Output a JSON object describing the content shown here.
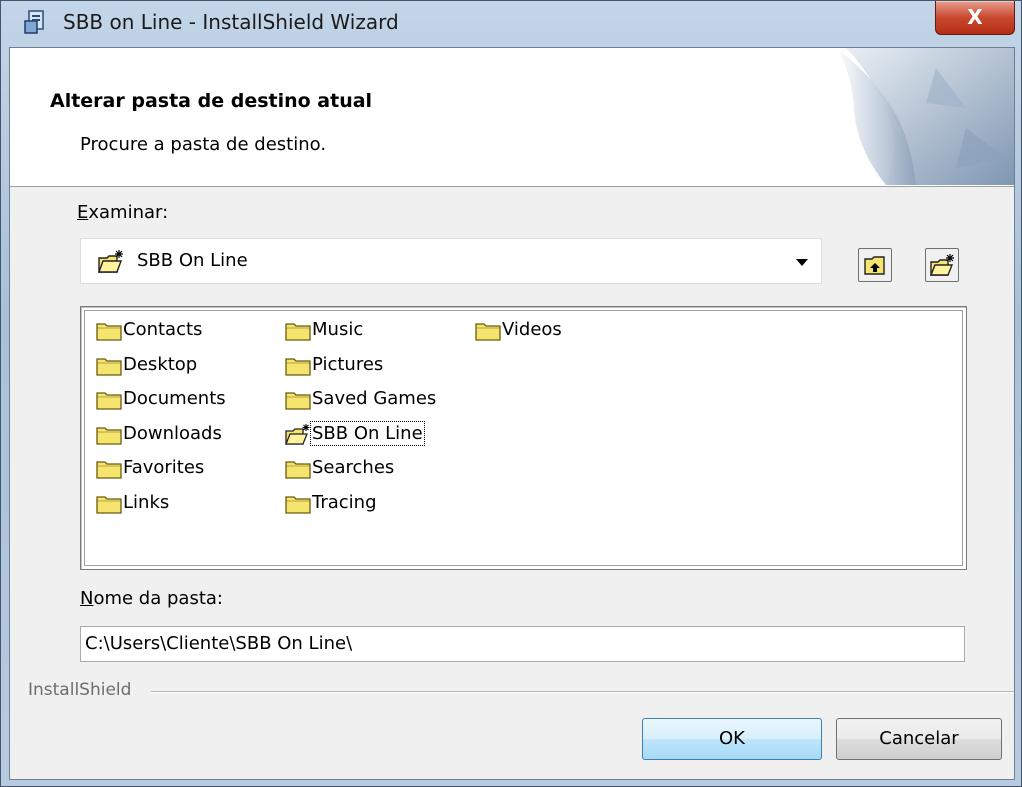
{
  "window": {
    "title": "SBB on Line - InstallShield Wizard",
    "close_glyph": "X"
  },
  "header": {
    "title": "Alterar pasta de destino atual",
    "subtitle": "Procure a pasta de destino."
  },
  "browse": {
    "label_accel": "E",
    "label_rest": "xaminar:",
    "selected_value": "SBB On Line",
    "up_folder_icon": "up-one-level-icon",
    "new_folder_icon": "new-folder-icon"
  },
  "folders": {
    "col1": [
      "Contacts",
      "Desktop",
      "Documents",
      "Downloads",
      "Favorites",
      "Links"
    ],
    "col2": [
      "Music",
      "Pictures",
      "Saved Games",
      "SBB On Line",
      "Searches",
      "Tracing"
    ],
    "col3": [
      "Videos"
    ],
    "selected": "SBB On Line"
  },
  "folder_name": {
    "label_accel": "N",
    "label_rest": "ome da pasta:",
    "value": "C:\\Users\\Cliente\\SBB On Line\\"
  },
  "footer": {
    "brand": "InstallShield",
    "ok_label": "OK",
    "cancel_label": "Cancelar"
  },
  "colors": {
    "folder_yellow": "#f5e46e",
    "folder_outline": "#6b5a0e",
    "default_button_border": "#3c7fb1",
    "close_red": "#c9482f"
  }
}
